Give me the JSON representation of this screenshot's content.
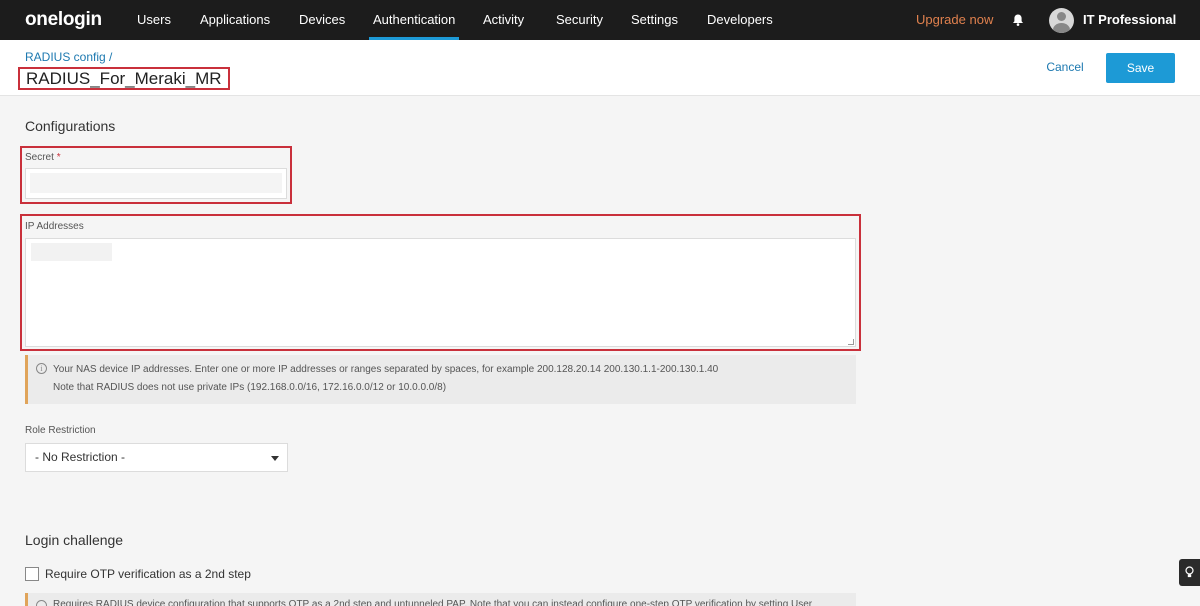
{
  "nav": {
    "logo": "onelogin",
    "items": [
      {
        "label": "Users"
      },
      {
        "label": "Applications"
      },
      {
        "label": "Devices"
      },
      {
        "label": "Authentication",
        "active": true
      },
      {
        "label": "Activity"
      },
      {
        "label": "Security"
      },
      {
        "label": "Settings"
      },
      {
        "label": "Developers"
      }
    ],
    "upgrade": "Upgrade now",
    "notifications_icon": "bell-icon",
    "user": "IT Professional"
  },
  "header": {
    "breadcrumb": "RADIUS config /",
    "title": "RADIUS_For_Meraki_MR",
    "cancel_label": "Cancel",
    "save_label": "Save"
  },
  "configurations": {
    "title": "Configurations",
    "secret_label": "Secret",
    "required_marker": "*",
    "secret_value": "",
    "ip_label": "IP Addresses",
    "ip_value": "",
    "hint_line1": "Your NAS device IP addresses. Enter one or more IP addresses or ranges separated by spaces, for example 200.128.20.14 200.130.1.1-200.130.1.40",
    "hint_line2": "Note that RADIUS does not use private IPs (192.168.0.0/16, 172.16.0.0/12 or 10.0.0.0/8)",
    "role_label": "Role Restriction",
    "role_value": "- No Restriction -"
  },
  "login_challenge": {
    "title": "Login challenge",
    "otp_label": "Require OTP verification as a 2nd step",
    "otp_checked": false,
    "hint": "Requires RADIUS device configuration that supports OTP as a 2nd step and untunneled PAP. Note that you can instead configure one-step OTP verification by setting User"
  },
  "colors": {
    "accent": "#1d9ad6",
    "link": "#1d79b0",
    "upgrade": "#e0814e",
    "highlight": "#c9303b",
    "nav_bg": "#1c1c1c"
  }
}
